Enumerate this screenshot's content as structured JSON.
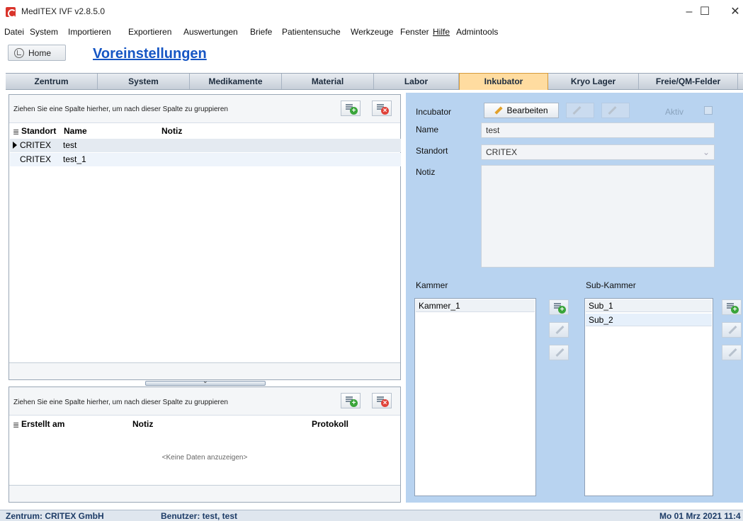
{
  "window": {
    "title": "MedITEX IVF v2.8.5.0",
    "controls": {
      "minimize": "–",
      "maximize": "☐",
      "close": "✕"
    }
  },
  "menu": [
    "Datei",
    "System",
    "Importieren",
    "Exportieren",
    "Auswertungen",
    "Briefe",
    "Patientensuche",
    "Werkzeuge",
    "Fenster",
    "Hilfe",
    "Admintools"
  ],
  "header": {
    "home_label": "Home",
    "page_title": "Voreinstellungen"
  },
  "tabs": [
    {
      "label": "Zentrum",
      "active": false
    },
    {
      "label": "System",
      "active": false
    },
    {
      "label": "Medikamente",
      "active": false
    },
    {
      "label": "Material",
      "active": false
    },
    {
      "label": "Labor",
      "active": false
    },
    {
      "label": "Inkubator",
      "active": true
    },
    {
      "label": "Kryo Lager",
      "active": false
    },
    {
      "label": "Freie/QM-Felder",
      "active": false
    }
  ],
  "incubator_grid": {
    "group_hint": "Ziehen Sie eine Spalte hierher, um nach dieser Spalte zu gruppieren",
    "columns": [
      "Standort",
      "Name",
      "Notiz"
    ],
    "rows": [
      {
        "standort": "CRITEX",
        "name": "test",
        "notiz": ""
      },
      {
        "standort": "CRITEX",
        "name": "test_1",
        "notiz": ""
      }
    ]
  },
  "protocol_grid": {
    "group_hint": "Ziehen Sie eine Spalte hierher, um nach dieser Spalte zu gruppieren",
    "columns": [
      "Erstellt am",
      "Notiz",
      "Protokoll"
    ],
    "empty_text": "<Keine Daten anzuzeigen>"
  },
  "detail": {
    "incubator_label": "Incubator",
    "edit_button": "Bearbeiten",
    "active_label": "Aktiv",
    "name_label": "Name",
    "name_value": "test",
    "location_label": "Standort",
    "location_value": "CRITEX",
    "notes_label": "Notiz",
    "notes_value": "",
    "chamber_label": "Kammer",
    "chambers": [
      "Kammer_1"
    ],
    "subchamber_label": "Sub-Kammer",
    "subchambers": [
      "Sub_1",
      "Sub_2"
    ]
  },
  "status": {
    "center": "Zentrum:  CRITEX GmbH",
    "user": "Benutzer: test, test",
    "datetime": "Mo 01 Mrz 2021 11:4"
  },
  "colors": {
    "accent": "#1656c4",
    "active_tab": "#ffdca0",
    "panel_bg": "#b8d3f0"
  }
}
